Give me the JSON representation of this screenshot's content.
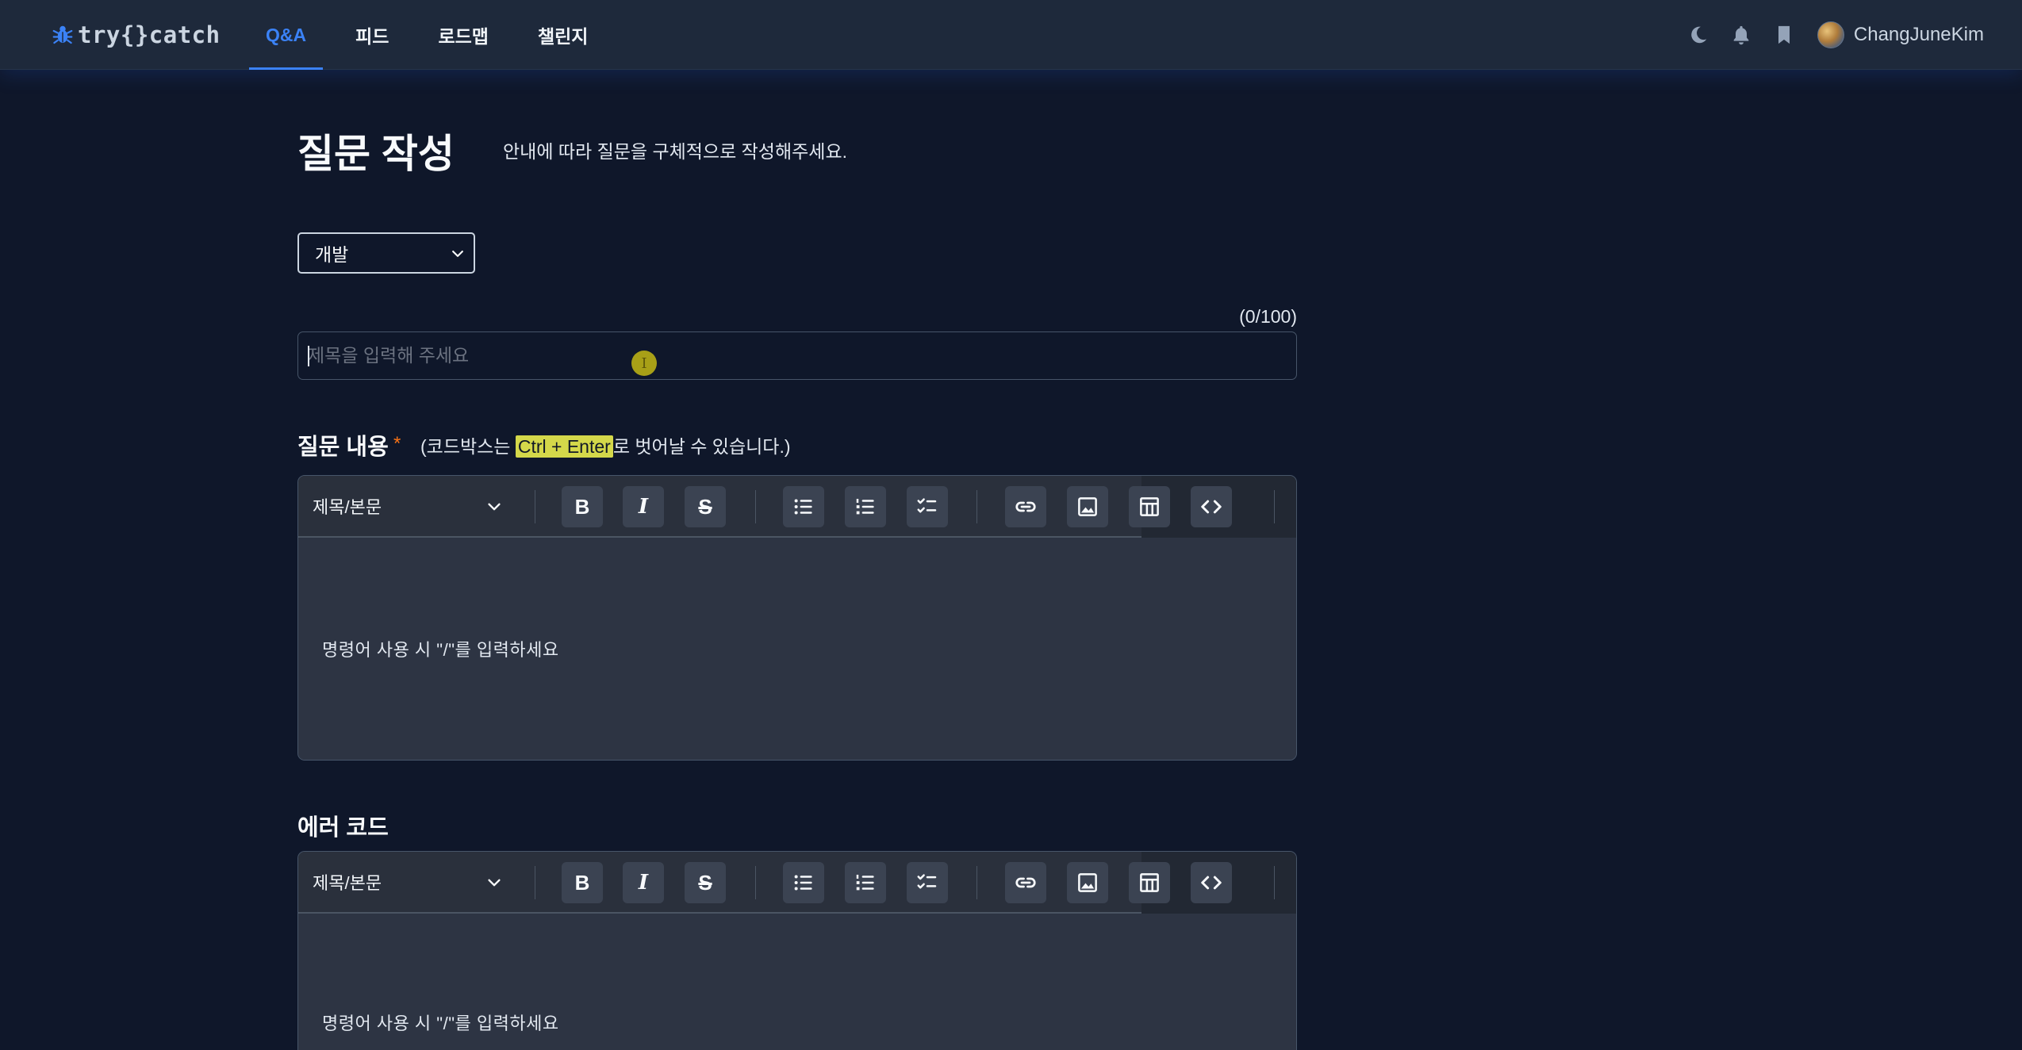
{
  "app": {
    "logo_text": "try{}catch",
    "nav": {
      "tabs": [
        {
          "label": "Q&A",
          "active": true
        },
        {
          "label": "피드",
          "active": false
        },
        {
          "label": "로드맵",
          "active": false
        },
        {
          "label": "챌린지",
          "active": false
        }
      ],
      "icons": [
        "moon-icon",
        "bell-icon",
        "bookmark-icon"
      ],
      "username": "ChangJuneKim"
    }
  },
  "page": {
    "title": "질문 작성",
    "subtitle": "안내에 따라 질문을 구체적으로 작성해주세요."
  },
  "form": {
    "category": {
      "selected": "개발"
    },
    "title": {
      "value": "",
      "placeholder": "제목을 입력해 주세요",
      "counter": "(0/100)"
    },
    "content": {
      "label": "질문 내용",
      "required_mark": "*",
      "hint_before": "(코드박스는 ",
      "hint_highlight": "Ctrl + Enter",
      "hint_after": "로 벗어날 수 있습니다.)",
      "heading_select": "제목/본문",
      "placeholder": "명령어 사용 시 \"/\"를 입력하세요"
    },
    "error_code": {
      "label": "에러 코드",
      "heading_select": "제목/본문",
      "placeholder": "명령어 사용 시 \"/\"를 입력하세요"
    }
  },
  "toolbar_buttons": [
    {
      "name": "bold-button",
      "icon": "bold-icon",
      "glyph": "B"
    },
    {
      "name": "italic-button",
      "icon": "italic-icon",
      "glyph": "I"
    },
    {
      "name": "strike-button",
      "icon": "strikethrough-icon",
      "glyph": "S"
    },
    {
      "name": "bullet-list-button",
      "icon": "bullet-list-icon"
    },
    {
      "name": "ordered-list-button",
      "icon": "ordered-list-icon"
    },
    {
      "name": "task-list-button",
      "icon": "task-list-icon"
    },
    {
      "name": "link-button",
      "icon": "link-icon"
    },
    {
      "name": "image-button",
      "icon": "image-icon"
    },
    {
      "name": "table-button",
      "icon": "table-icon"
    },
    {
      "name": "code-button",
      "icon": "code-icon"
    }
  ],
  "colors": {
    "background": "#0f172a",
    "navbar": "#1e293b",
    "accent": "#3b82f6",
    "required": "#f97316",
    "highlight": "#d4d84a"
  }
}
